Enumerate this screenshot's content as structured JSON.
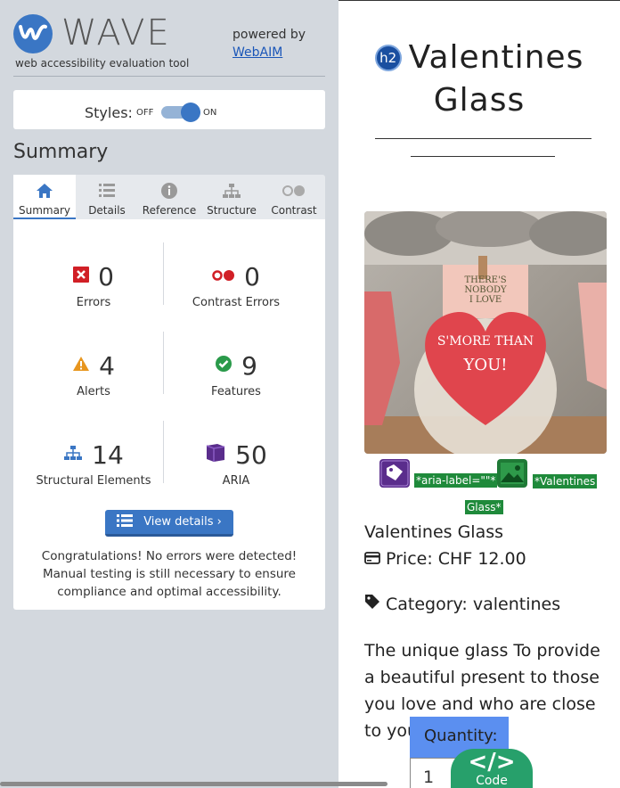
{
  "wave": {
    "logo_text": "WAVE",
    "tagline": "web accessibility evaluation tool",
    "powered_by": "powered by",
    "webaim_link": "WebAIM",
    "accent_color": "#3a76c4"
  },
  "styles": {
    "label": "Styles:",
    "off": "OFF",
    "on": "ON",
    "state": "on"
  },
  "summary_heading": "Summary",
  "tabs": [
    {
      "label": "Summary",
      "icon": "home-icon",
      "active": true
    },
    {
      "label": "Details",
      "icon": "list-icon",
      "active": false
    },
    {
      "label": "Reference",
      "icon": "info-icon",
      "active": false
    },
    {
      "label": "Structure",
      "icon": "sitemap-icon",
      "active": false
    },
    {
      "label": "Contrast",
      "icon": "contrast-icon",
      "active": false
    }
  ],
  "stats": {
    "errors": {
      "value": "0",
      "label": "Errors"
    },
    "contrast_errors": {
      "value": "0",
      "label": "Contrast Errors"
    },
    "alerts": {
      "value": "4",
      "label": "Alerts"
    },
    "features": {
      "value": "9",
      "label": "Features"
    },
    "structural": {
      "value": "14",
      "label": "Structural Elements"
    },
    "aria": {
      "value": "50",
      "label": "ARIA"
    }
  },
  "view_details": "View details ›",
  "congrats": "Congratulations! No errors were detected! Manual testing is still necessary to ensure compliance and optimal accessibility.",
  "page": {
    "h2_badge": "h2",
    "title": "Valentines Glass",
    "aria_label_tag": "*aria-label=\"\"*",
    "alt_tag_part1": "*Valentines",
    "alt_tag_part2": "Glass*",
    "product_name": "Valentines Glass",
    "price": "Price: CHF 12.00",
    "category": "Category: valentines",
    "description": "The unique glass To provide a beautiful present to those you love and who are close to you.",
    "quantity_label": "Quantity:",
    "quantity_value": "1",
    "code_label": "Code",
    "image_text": [
      "THERE'S NOBODY",
      "I LOVE",
      "S'MORE THAN",
      "YOU!"
    ]
  }
}
